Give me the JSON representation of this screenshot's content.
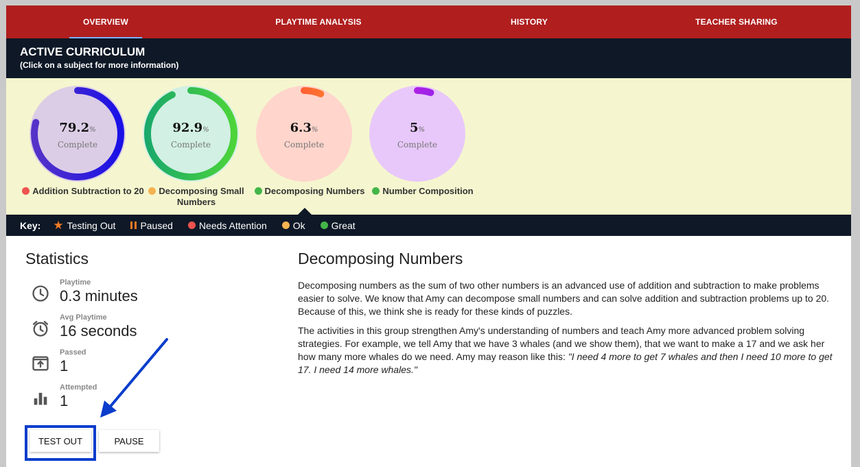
{
  "nav": {
    "tabs": [
      {
        "label": "OVERVIEW",
        "active": true
      },
      {
        "label": "PLAYTIME ANALYSIS",
        "active": false
      },
      {
        "label": "HISTORY",
        "active": false
      },
      {
        "label": "TEACHER SHARING",
        "active": false
      }
    ],
    "bar_color": "#b01e1e",
    "active_indicator_color": "#7ab0ff"
  },
  "curriculum": {
    "title": "ACTIVE CURRICULUM",
    "subtitle": "(Click on a subject for more information)",
    "subjects": [
      {
        "value": "79.2",
        "unit": "%",
        "complete_label": "Complete",
        "label": "Addition Subtraction to 20",
        "status": "needs-attention",
        "fill": "#dccde6",
        "ring_start": "#5533c8",
        "ring_end": "#1a10e6",
        "progress": 0.792
      },
      {
        "value": "92.9",
        "unit": "%",
        "complete_label": "Complete",
        "label": "Decomposing Small Numbers",
        "status": "ok",
        "fill": "#d2f0e4",
        "ring_start": "#1aa96a",
        "ring_end": "#4cd43a",
        "progress": 0.929
      },
      {
        "value": "6.3",
        "unit": "%",
        "complete_label": "Complete",
        "label": "Decomposing Numbers",
        "status": "great",
        "fill": "#ffd5cc",
        "ring_start": "#ff3a3a",
        "ring_end": "#ff8a2a",
        "progress": 0.063
      },
      {
        "value": "5",
        "unit": "%",
        "complete_label": "Complete",
        "label": "Number Composition",
        "status": "great",
        "fill": "#e8c8fa",
        "ring_start": "#cc22dd",
        "ring_end": "#8822ee",
        "progress": 0.05
      }
    ]
  },
  "key": {
    "title": "Key:",
    "items": [
      {
        "label": "Testing Out",
        "icon": "star-icon"
      },
      {
        "label": "Paused",
        "icon": "pause-icon"
      },
      {
        "label": "Needs Attention",
        "icon": "red-dot-icon"
      },
      {
        "label": "Ok",
        "icon": "orange-dot-icon"
      },
      {
        "label": "Great",
        "icon": "green-dot-icon"
      }
    ],
    "status_colors": {
      "needs-attention": "#ef5350",
      "ok": "#f4b350",
      "great": "#43b649",
      "testing-out": "#f47a23"
    }
  },
  "statistics": {
    "title": "Statistics",
    "items": [
      {
        "label": "Playtime",
        "value": "0.3 minutes",
        "icon": "clock-icon"
      },
      {
        "label": "Avg Playtime",
        "value": "16 seconds",
        "icon": "alarm-clock-icon"
      },
      {
        "label": "Passed",
        "value": "1",
        "icon": "publish-icon"
      },
      {
        "label": "Attempted",
        "value": "1",
        "icon": "bar-chart-icon"
      }
    ],
    "buttons": {
      "test_out": "TEST OUT",
      "pause": "PAUSE"
    }
  },
  "detail": {
    "title": "Decomposing Numbers",
    "paragraph1": "Decomposing numbers as the sum of two other numbers is an advanced use of addition and subtraction to make problems easier to solve. We know that Amy can decompose small numbers and can solve addition and subtraction problems up to 20. Because of this, we think she is ready for these kinds of puzzles.",
    "paragraph2_plain": "The activities in this group strengthen Amy's understanding of numbers and teach Amy more advanced problem solving strategies. For example, we tell Amy that we have 3 whales (and we show them), that we want to make a 17 and we ask her how many more whales do we need. Amy may reason like this: ",
    "paragraph2_quote": "\"I need 4 more to get 7 whales and then I need 10 more to get 17. I need 14 more whales.\""
  }
}
